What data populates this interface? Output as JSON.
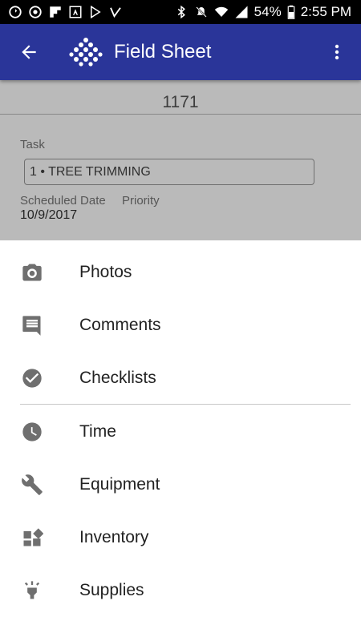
{
  "status_bar": {
    "battery": "54%",
    "time": "2:55 PM"
  },
  "app_bar": {
    "title": "Field Sheet"
  },
  "record": {
    "id": "1171",
    "task_label": "Task",
    "task_value": "1 • TREE TRIMMING",
    "scheduled_date_label": "Scheduled Date",
    "priority_label": "Priority",
    "scheduled_date_value": "10/9/2017"
  },
  "sheet": {
    "items": [
      {
        "label": "Photos",
        "icon": "camera-icon"
      },
      {
        "label": "Comments",
        "icon": "comment-icon"
      },
      {
        "label": "Checklists",
        "icon": "check-circle-icon"
      },
      {
        "label": "Time",
        "icon": "clock-icon"
      },
      {
        "label": "Equipment",
        "icon": "wrench-icon"
      },
      {
        "label": "Inventory",
        "icon": "inventory-icon"
      },
      {
        "label": "Supplies",
        "icon": "lightbulb-icon"
      }
    ]
  },
  "colors": {
    "app_bar": "#2a3599",
    "icon_gray": "#6f6f6f"
  }
}
